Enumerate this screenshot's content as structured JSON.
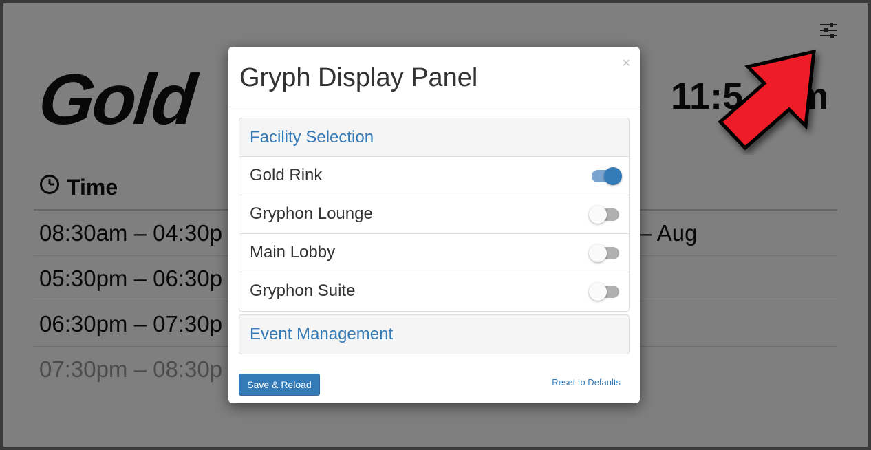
{
  "page": {
    "rink_title": "Gold",
    "clock": "11:5",
    "clock_suffix": "m",
    "time_header": "Time",
    "schedule": [
      {
        "time": "08:30am – 04:30p",
        "event": "– Aug"
      },
      {
        "time": "05:30pm – 06:30p",
        "event": ""
      },
      {
        "time": "06:30pm – 07:30p",
        "event": ""
      },
      {
        "time": "07:30pm – 08:30p",
        "event": ""
      }
    ]
  },
  "modal": {
    "title": "Gryph Display Panel",
    "close": "×",
    "facility_heading": "Facility Selection",
    "facilities": [
      {
        "label": "Gold Rink",
        "enabled": true
      },
      {
        "label": "Gryphon Lounge",
        "enabled": false
      },
      {
        "label": "Main Lobby",
        "enabled": false
      },
      {
        "label": "Gryphon Suite",
        "enabled": false
      }
    ],
    "event_heading": "Event Management",
    "save_label": "Save & Reload",
    "reset_label": "Reset to Defaults"
  },
  "icons": {
    "settings": "sliders-icon",
    "clock": "clock-icon",
    "arrow": "red-arrow-annotation"
  },
  "colors": {
    "accent": "#337ab7",
    "arrow": "#ee1c25",
    "overlay": "rgba(0,0,0,0.5)"
  }
}
